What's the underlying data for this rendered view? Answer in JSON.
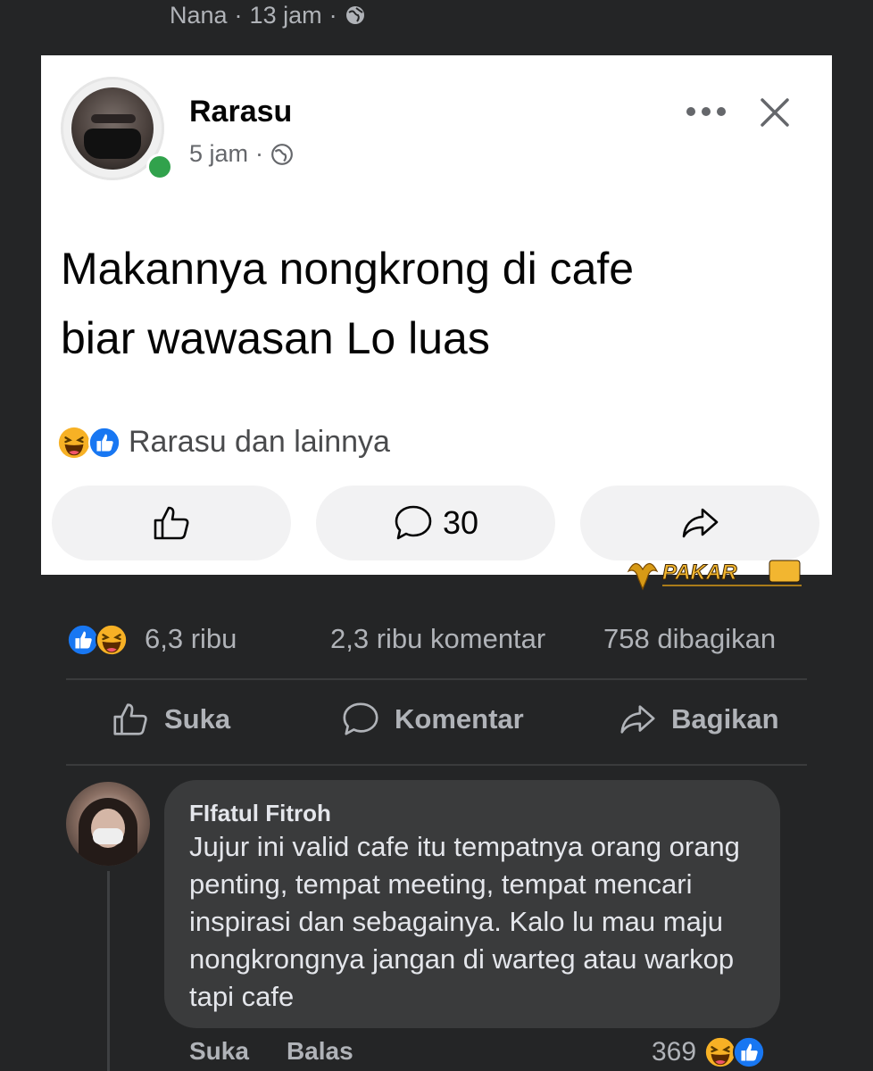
{
  "top_header": {
    "author": "Nana",
    "separator": "·",
    "time": "13 jam",
    "separator2": "·",
    "privacy_icon": "globe-icon"
  },
  "shared_post": {
    "author": "Rarasu",
    "time": "5 jam",
    "separator": "·",
    "privacy_icon": "globe-icon",
    "text_line1": "Makannya nongkrong di cafe",
    "text_line2": "biar wawasan Lo luas",
    "reaction_summary": "Rarasu dan lainnya",
    "reaction_icons": [
      "haha-icon",
      "like-icon"
    ],
    "comment_count": "30",
    "online": true
  },
  "watermark": "PAKAR",
  "post_stats": {
    "reactions": "6,3 ribu",
    "comments": "2,3 ribu komentar",
    "shares": "758 dibagikan"
  },
  "actions": {
    "like": "Suka",
    "comment": "Komentar",
    "share": "Bagikan"
  },
  "comment": {
    "author": "FIfatul Fitroh",
    "text": "Jujur ini valid cafe itu tempatnya orang orang penting, tempat meeting, tempat mencari inspirasi dan sebagainya. Kalo lu mau maju nongkrongnya jangan di warteg atau warkop tapi cafe",
    "like_action": "Suka",
    "reply_action": "Balas",
    "reaction_count": "369"
  },
  "colors": {
    "background": "#242526",
    "like_blue": "#1877f2",
    "haha_yellow": "#f7b125",
    "online_green": "#31a24c"
  }
}
